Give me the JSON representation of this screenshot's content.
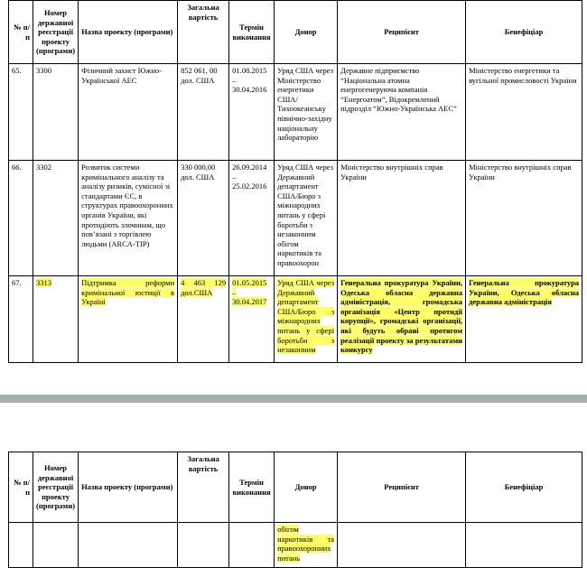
{
  "headers": {
    "num": "№ п/п",
    "reg": "Номер державної реєстрації проекту (програми)",
    "name": "Назва проекту (програми)",
    "cost": "Загальна вартість",
    "term": "Термін виконання",
    "donor": "Донор",
    "recipient": "Реципієнт",
    "beneficiary": "Бенефіціар"
  },
  "rows": [
    {
      "num": "65.",
      "reg": "3300",
      "name": "Фізичний захист Южно-Української АЕС",
      "cost": "852 061, 00 дол. США",
      "term": "01.08.2015 – 30.04.2016",
      "donor": "Уряд США через Міністерство енергетики США/Тихоокеанську північно-західну національну лабораторію",
      "recipient": "Державне підприємство “Національна атомна енергогенеруюча компанія “Енергоатом”, Відокремлений підрозділ “Южно-Українська АЕС”",
      "beneficiary": "Міністерство енергетики та вугільної промисловості України"
    },
    {
      "num": "66.",
      "reg": "3302",
      "name": "Розвиток системи кримінального аналізу та аналізу ризиків, сумісної зі стандартами ЄС, в структурах правоохоронних органів України, які протидіють злочинам, що пов’язані з торгівлею людьми (ARCA-TIP)",
      "cost": "330 000,00 дол. США",
      "term": "26.09.2014 – 25.02.2016",
      "donor": "Уряд США через Державний департамент США/Бюро з міжнародних питань у сфері боротьби з незаконним обігом наркотиків та правоохорон",
      "recipient": "Міністерство внутрішніх справ України",
      "beneficiary": "Міністерство внутрішніх справ України"
    },
    {
      "num": "67.",
      "reg": "3313",
      "name": "Підтримка реформи кримінальної юстиції в Україні",
      "cost": "4 463 129 дол.США",
      "term": "01.05.2015 – 30.04.2017",
      "donor": "Уряд США через Державний департамент США/Бюро з міжнародних питань у сфері боротьби з незаконним",
      "recipient": "Генеральна прокуратура України, Одеська обласна державна адміністрація, громадська організація «Центр протидії корупції», громадські організації, які будуть обрані протягом реалізації проекту за результатами конкурсу",
      "beneficiary": "Генеральна прокуратура України, Одеська обласна державна адміністрація"
    }
  ],
  "continuation": {
    "donor": "обігом наркотиків та правоохоронних питань"
  },
  "colors": {
    "highlight": "#ffff66",
    "page_separator": "#a9aeb3"
  }
}
